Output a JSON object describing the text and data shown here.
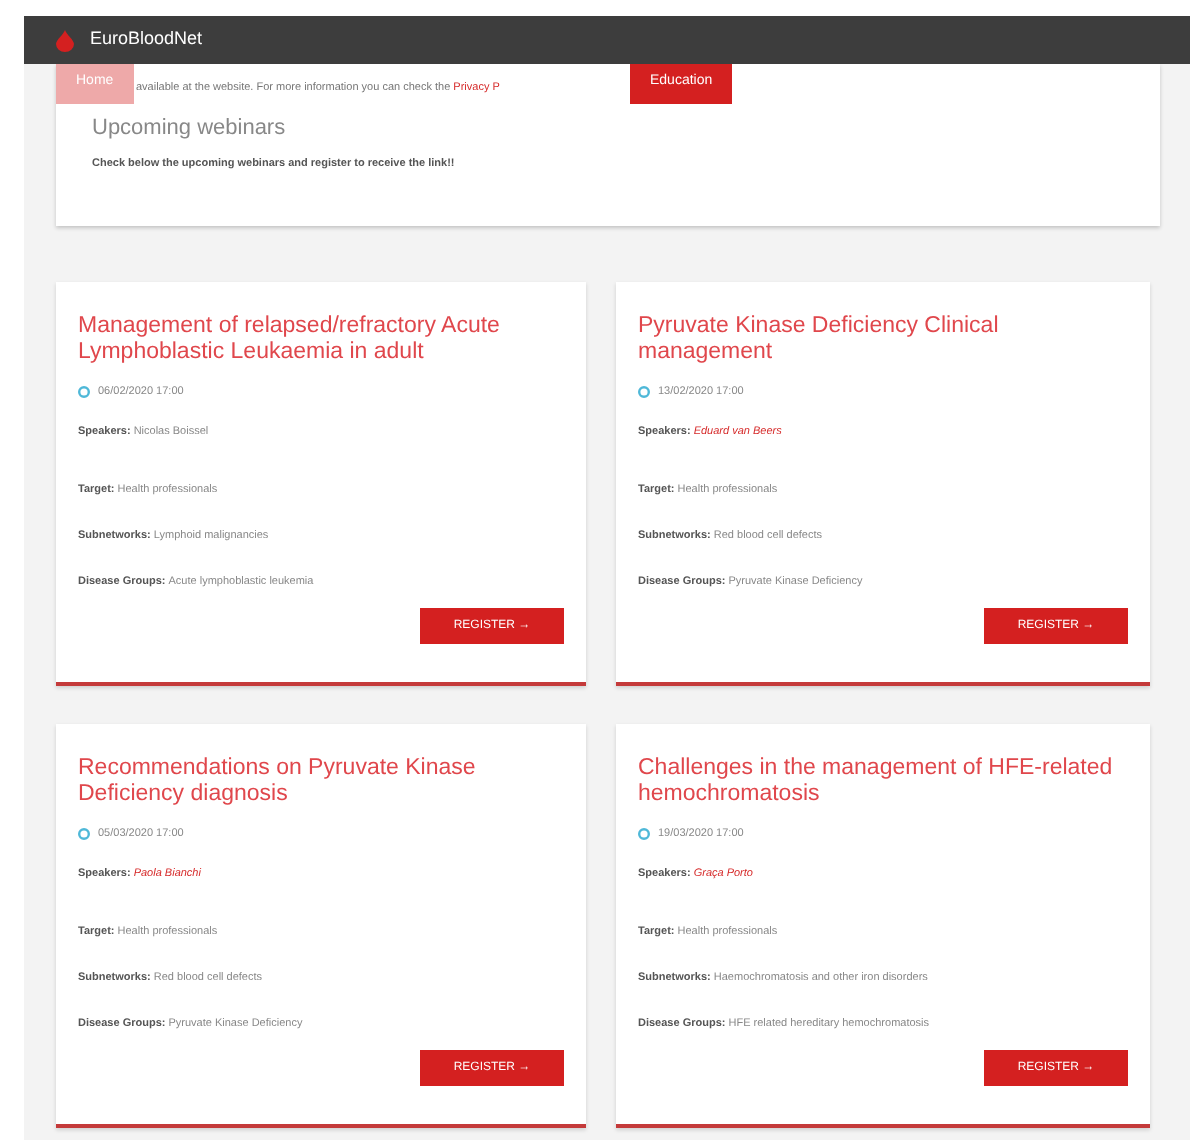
{
  "navbar": {
    "brand": "EuroBloodNet"
  },
  "notice": {
    "text": "available at the website. For more information you can check the ",
    "link": "Privacy P"
  },
  "overlay_buttons": [
    {
      "label": "Home",
      "faded": true
    },
    {
      "label": "Education",
      "faded": false
    }
  ],
  "intro": {
    "title": "Upcoming webinars",
    "text": "Check below the upcoming webinars and register to receive the link!!"
  },
  "webinars": [
    {
      "title": "Management of relapsed/refractory Acute Lymphoblastic Leukaemia in adult",
      "date": "06/02/2020 17:00",
      "speakers_label": "Speakers:",
      "speakers": "Nicolas Boissel",
      "speaker_link": false,
      "target_label": "Target:",
      "target": "Health professionals",
      "subnetworks_label": "Subnetworks:",
      "subnetworks": "Lymphoid malignancies",
      "disease_groups_label": "Disease Groups:",
      "disease_groups": "Acute lymphoblastic leukemia",
      "button": "REGISTER →"
    },
    {
      "title": "Pyruvate Kinase Deficiency Clinical management",
      "date": "13/02/2020 17:00",
      "speakers_label": "Speakers:",
      "speakers": "Eduard van Beers",
      "speaker_link": true,
      "target_label": "Target:",
      "target": "Health professionals",
      "subnetworks_label": "Subnetworks:",
      "subnetworks": "Red blood cell defects",
      "disease_groups_label": "Disease Groups:",
      "disease_groups": "Pyruvate Kinase Deficiency",
      "button": "REGISTER →"
    },
    {
      "title": "Recommendations on Pyruvate Kinase Deficiency diagnosis",
      "date": "05/03/2020 17:00",
      "speakers_label": "Speakers:",
      "speakers": "Paola Bianchi",
      "speaker_link": true,
      "target_label": "Target:",
      "target": "Health professionals",
      "subnetworks_label": "Subnetworks:",
      "subnetworks": "Red blood cell defects",
      "disease_groups_label": "Disease Groups:",
      "disease_groups": "Pyruvate Kinase Deficiency",
      "button": "REGISTER →"
    },
    {
      "title": "Challenges in the management of HFE-related hemochromatosis",
      "date": "19/03/2020 17:00",
      "speakers_label": "Speakers:",
      "speakers": "Graça Porto",
      "speaker_link": true,
      "target_label": "Target:",
      "target": "Health professionals",
      "subnetworks_label": "Subnetworks:",
      "subnetworks": "Haemochromatosis and other iron disorders",
      "disease_groups_label": "Disease Groups:",
      "disease_groups": "HFE related hereditary hemochromatosis",
      "button": "REGISTER →"
    }
  ]
}
